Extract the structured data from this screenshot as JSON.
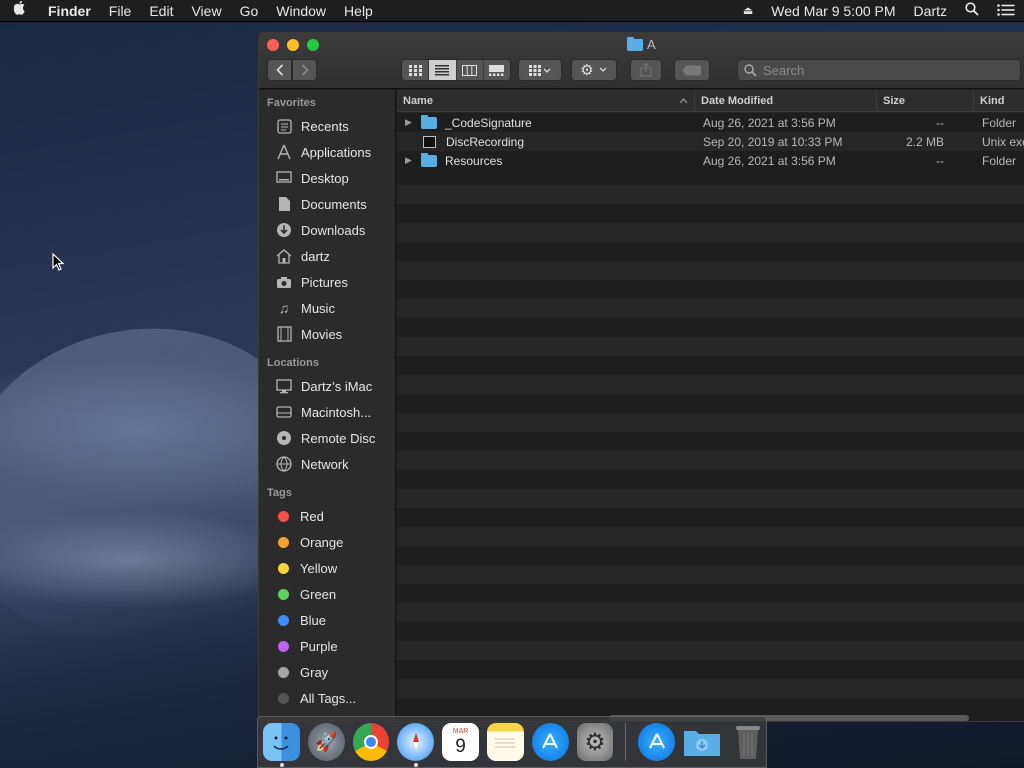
{
  "menubar": {
    "app_name": "Finder",
    "items": [
      "File",
      "Edit",
      "View",
      "Go",
      "Window",
      "Help"
    ],
    "clock": "Wed Mar 9  5:00 PM",
    "user": "Dartz"
  },
  "window": {
    "title": "A",
    "search_placeholder": "Search",
    "active_view": "list"
  },
  "sidebar": {
    "favorites_header": "Favorites",
    "favorites": [
      {
        "label": "Recents",
        "icon": "clock-icon"
      },
      {
        "label": "Applications",
        "icon": "applications-icon"
      },
      {
        "label": "Desktop",
        "icon": "desktop-icon"
      },
      {
        "label": "Documents",
        "icon": "document-icon"
      },
      {
        "label": "Downloads",
        "icon": "download-icon"
      },
      {
        "label": "dartz",
        "icon": "home-icon"
      },
      {
        "label": "Pictures",
        "icon": "camera-icon"
      },
      {
        "label": "Music",
        "icon": "music-icon"
      },
      {
        "label": "Movies",
        "icon": "film-icon"
      }
    ],
    "locations_header": "Locations",
    "locations": [
      {
        "label": "Dartz’s iMac",
        "icon": "computer-icon"
      },
      {
        "label": "Macintosh...",
        "icon": "hard-drive-icon"
      },
      {
        "label": "Remote Disc",
        "icon": "disc-icon"
      },
      {
        "label": "Network",
        "icon": "network-icon"
      }
    ],
    "tags_header": "Tags",
    "tags": [
      {
        "label": "Red",
        "color": "#f2504b"
      },
      {
        "label": "Orange",
        "color": "#f5a033"
      },
      {
        "label": "Yellow",
        "color": "#f6d53a"
      },
      {
        "label": "Green",
        "color": "#5bd35c"
      },
      {
        "label": "Blue",
        "color": "#3f8ef5"
      },
      {
        "label": "Purple",
        "color": "#bf63e8"
      },
      {
        "label": "Gray",
        "color": "#a5a5a5"
      },
      {
        "label": "All Tags...",
        "color": "#555555"
      }
    ]
  },
  "columns": {
    "name": "Name",
    "date": "Date Modified",
    "size": "Size",
    "kind": "Kind"
  },
  "files": [
    {
      "name": "_CodeSignature",
      "date": "Aug 26, 2021 at 3:56 PM",
      "size": "--",
      "kind": "Folder",
      "type": "folder",
      "expandable": true
    },
    {
      "name": "DiscRecording",
      "date": "Sep 20, 2019 at 10:33 PM",
      "size": "2.2 MB",
      "kind": "Unix executable",
      "type": "exec",
      "expandable": false
    },
    {
      "name": "Resources",
      "date": "Aug 26, 2021 at 3:56 PM",
      "size": "--",
      "kind": "Folder",
      "type": "folder",
      "expandable": true
    }
  ],
  "dock": [
    {
      "name": "finder",
      "running": true
    },
    {
      "name": "launchpad",
      "running": false
    },
    {
      "name": "chrome",
      "running": false
    },
    {
      "name": "safari",
      "running": true
    },
    {
      "name": "calendar",
      "running": false,
      "month": "MAR",
      "day": "9"
    },
    {
      "name": "notes",
      "running": false
    },
    {
      "name": "app-store",
      "running": false
    },
    {
      "name": "system-preferences",
      "running": false
    },
    {
      "name": "app-store-folder",
      "running": false
    },
    {
      "name": "downloads-folder",
      "running": false
    },
    {
      "name": "trash",
      "running": false
    }
  ]
}
